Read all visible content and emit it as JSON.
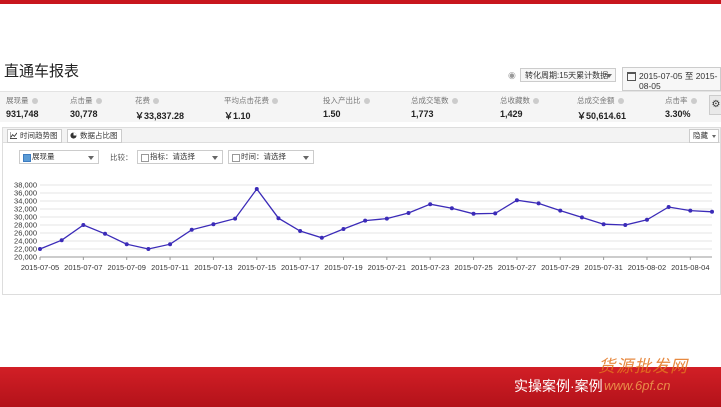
{
  "report": {
    "title": "直通车报表",
    "period_select": "转化周期:15天累计数据",
    "date_range": "2015-07-05 至 2015-08-05"
  },
  "metrics": [
    {
      "label": "展现量",
      "value": "931,748"
    },
    {
      "label": "点击量",
      "value": "30,778"
    },
    {
      "label": "花费",
      "value": "￥33,837.28"
    },
    {
      "label": "平均点击花费",
      "value": "￥1.10"
    },
    {
      "label": "投入产出比",
      "value": "1.50"
    },
    {
      "label": "总成交笔数",
      "value": "1,773"
    },
    {
      "label": "总收藏数",
      "value": "1,429"
    },
    {
      "label": "总成交金额",
      "value": "￥50,614.61"
    },
    {
      "label": "点击率",
      "value": "3.30%"
    }
  ],
  "tabs": {
    "trend": "时间趋势图",
    "share": "数据占比图",
    "hide": "隐藏"
  },
  "controls": {
    "metric_select": "展现量",
    "compare_label": "比较：",
    "indicator_select": "指标：请选择",
    "time_select": "时间：请选择"
  },
  "chart_data": {
    "type": "line",
    "x": [
      "2015-07-05",
      "2015-07-06",
      "2015-07-07",
      "2015-07-08",
      "2015-07-09",
      "2015-07-10",
      "2015-07-11",
      "2015-07-12",
      "2015-07-13",
      "2015-07-14",
      "2015-07-15",
      "2015-07-16",
      "2015-07-17",
      "2015-07-18",
      "2015-07-19",
      "2015-07-20",
      "2015-07-21",
      "2015-07-22",
      "2015-07-23",
      "2015-07-24",
      "2015-07-25",
      "2015-07-26",
      "2015-07-27",
      "2015-07-28",
      "2015-07-29",
      "2015-07-30",
      "2015-07-31",
      "2015-08-01",
      "2015-08-02",
      "2015-08-03",
      "2015-08-04",
      "2015-08-05"
    ],
    "x_tick_labels": [
      "2015-07-05",
      "2015-07-07",
      "2015-07-09",
      "2015-07-11",
      "2015-07-13",
      "2015-07-15",
      "2015-07-17",
      "2015-07-19",
      "2015-07-21",
      "2015-07-23",
      "2015-07-25",
      "2015-07-27",
      "2015-07-29",
      "2015-07-31",
      "2015-08-02",
      "2015-08-04"
    ],
    "series": [
      {
        "values": [
          22000,
          24200,
          28000,
          25800,
          23200,
          22000,
          23200,
          26800,
          28200,
          29600,
          37000,
          29700,
          26500,
          24800,
          27000,
          29100,
          29600,
          31000,
          33200,
          32200,
          30800,
          30900,
          34200,
          33400,
          31600,
          29900,
          28200,
          28000,
          29300,
          32500,
          31600,
          31300
        ]
      }
    ],
    "ylim": [
      20000,
      38000
    ],
    "y_ticks": [
      20000,
      22000,
      24000,
      26000,
      28000,
      30000,
      32000,
      34000,
      36000,
      38000
    ],
    "y_tick_labels": [
      "20,000",
      "22,000",
      "24,000",
      "26,000",
      "28,000",
      "30,000",
      "32,000",
      "34,000",
      "36,000",
      "38,000"
    ],
    "colors": {
      "line": "#3b2bb8",
      "grid": "#e6e6e6"
    },
    "grid": true
  },
  "footer": {
    "text": "实操案例·案例"
  },
  "watermark": {
    "site_cn": "货源批发网",
    "site_url": "www.6pf.cn"
  }
}
